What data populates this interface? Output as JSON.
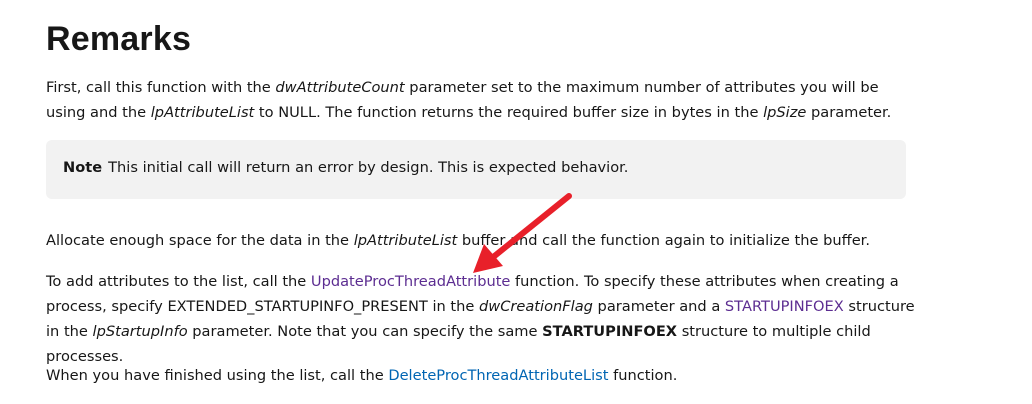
{
  "heading": "Remarks",
  "p1": {
    "t1": "First, call this function with the ",
    "i1": "dwAttributeCount",
    "t2": " parameter set to the maximum number of attributes you will be using and the ",
    "i2": "lpAttributeList",
    "t3": " to NULL. The function returns the required buffer size in bytes in the ",
    "i3": "lpSize",
    "t4": " parameter."
  },
  "note": {
    "label": "Note",
    "text": "This initial call will return an error by design. This is expected behavior."
  },
  "p2": {
    "t1": "Allocate enough space for the data in the ",
    "i1": "lpAttributeList",
    "t2": " buffer and call the function again to initialize the buffer."
  },
  "p3": {
    "t1": "To add attributes to the list, call the ",
    "link1": "UpdateProcThreadAttribute",
    "t2": " function. To specify these attributes when creating a process, specify EXTENDED_STARTUPINFO_PRESENT in the ",
    "i1": "dwCreationFlag",
    "t3": " parameter and a ",
    "link2": "STARTUPINFOEX",
    "t4": " structure in the ",
    "i2": "lpStartupInfo",
    "t5": " parameter. Note that you can specify the same ",
    "b1": "STARTUPINFOEX",
    "t6": " structure to multiple child processes."
  },
  "p4": {
    "t1": "When you have finished using the list, call the ",
    "link1": "DeleteProcThreadAttributeList",
    "t2": " function."
  },
  "colors": {
    "visited_link": "#5c2d91",
    "link": "#0065b3",
    "annotation_arrow": "#e8202a",
    "note_bg": "#f2f2f2"
  }
}
